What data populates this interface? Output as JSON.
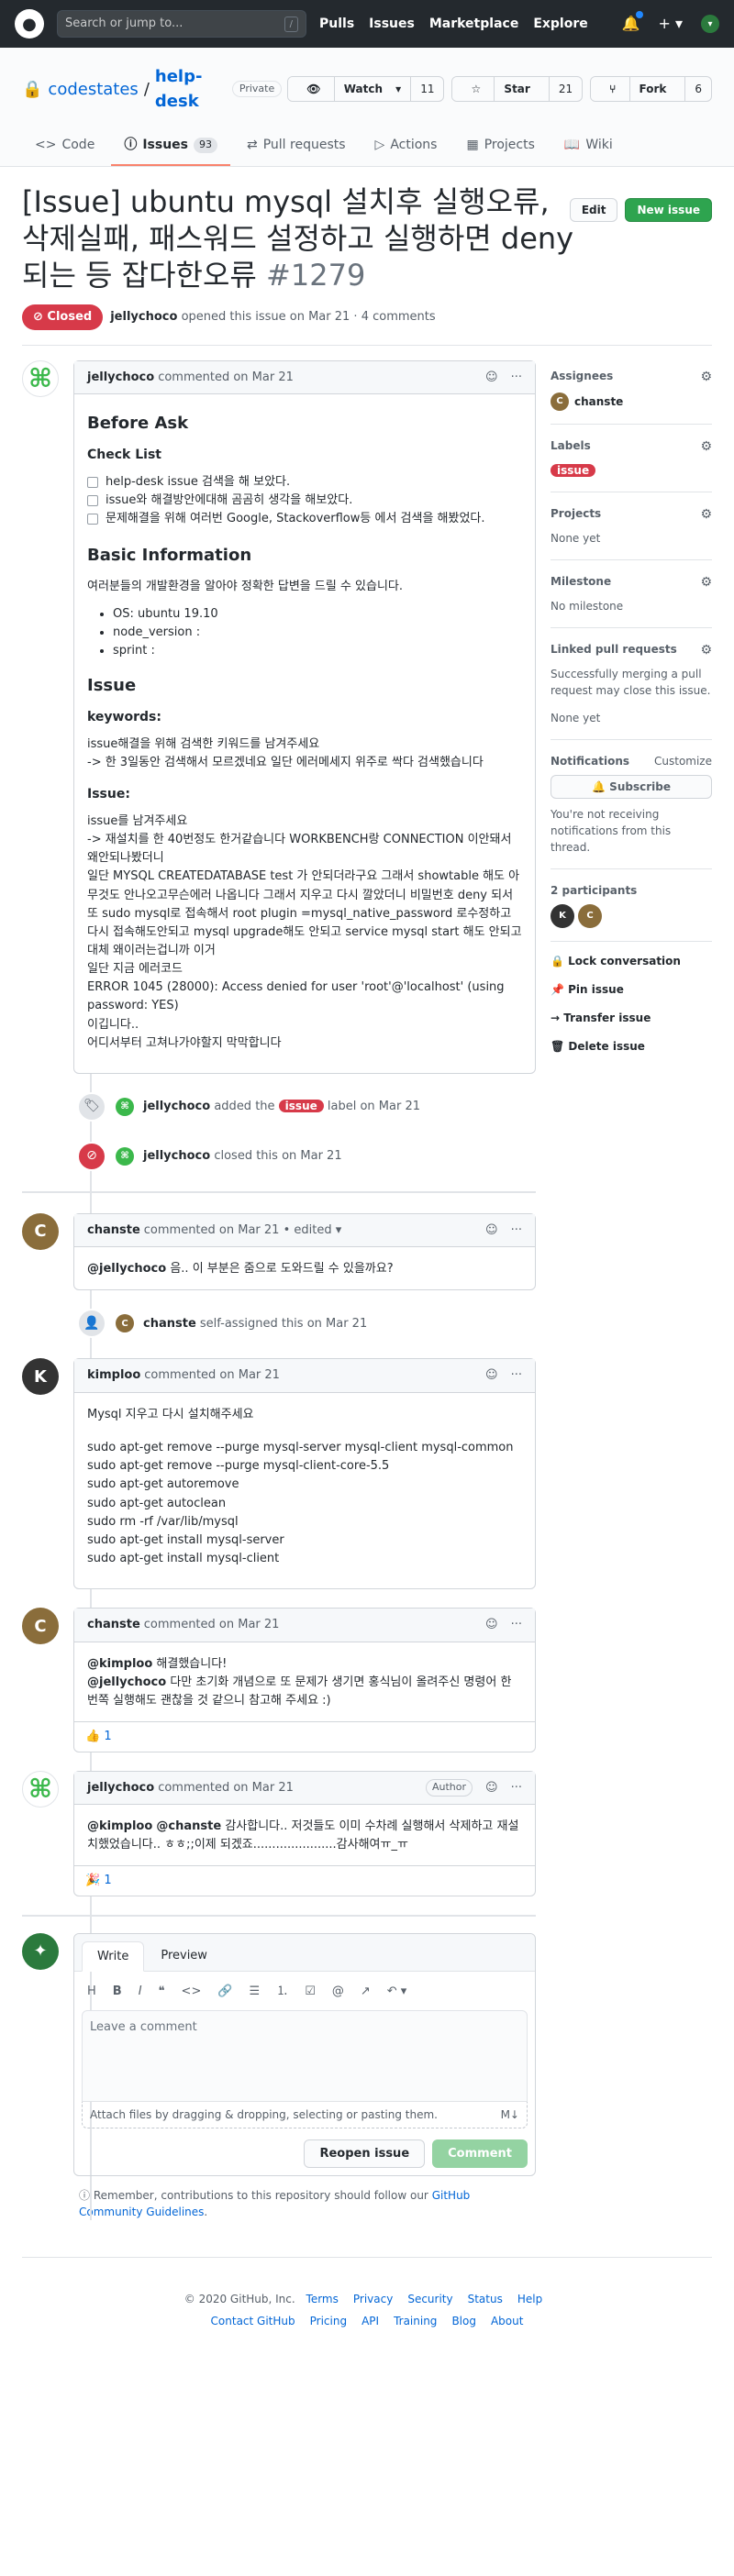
{
  "header": {
    "search_placeholder": "Search or jump to...",
    "search_kbd": "/",
    "nav": [
      "Pulls",
      "Issues",
      "Marketplace",
      "Explore"
    ]
  },
  "repo": {
    "owner": "codestates",
    "name": "help-desk",
    "visibility": "Private",
    "watch_label": "Watch",
    "watch_count": "11",
    "star_label": "Star",
    "star_count": "21",
    "fork_label": "Fork",
    "fork_count": "6",
    "tabs": [
      {
        "label": "Code"
      },
      {
        "label": "Issues",
        "count": "93"
      },
      {
        "label": "Pull requests"
      },
      {
        "label": "Actions"
      },
      {
        "label": "Projects"
      },
      {
        "label": "Wiki"
      }
    ]
  },
  "issue": {
    "title": "[Issue] ubuntu mysql 설치후 실행오류, 삭제실패, 패스워드 설정하고 실행하면 deny되는 등 잡다한오류",
    "number": "#1279",
    "edit_label": "Edit",
    "new_label": "New issue",
    "state": "Closed",
    "author": "jellychoco",
    "meta": "opened this issue on Mar 21 · 4 comments"
  },
  "first_comment": {
    "author": "jellychoco",
    "meta": "commented on Mar 21",
    "h_before": "Before Ask",
    "h_checklist": "Check List",
    "checklist": [
      "help-desk issue 검색을 해 보았다.",
      "issue와 해결방안에대해 곰곰히 생각을 해보았다.",
      "문제해결을 위해 여러번 Google, Stackoverflow등 에서 검색을 해봤었다."
    ],
    "h_basic": "Basic Information",
    "basic_intro": "여러분들의 개발환경을 알아야 정확한 답변을 드릴 수 있습니다.",
    "basic_list": [
      "OS: ubuntu 19.10",
      "node_version :",
      "sprint :"
    ],
    "h_issue": "Issue",
    "h_keywords": "keywords:",
    "keywords_text": "issue해결을 위해 검색한 키워드를 남겨주세요\n-> 한 3일동안 검색해서 모르겠네요 일단 에러메세지 위주로 싹다 검색했습니다",
    "h_issue2": "Issue:",
    "issue_text": "issue를 남겨주세요\n-> 재설치를 한 40번정도 한거같습니다 WORKBENCH랑 CONNECTION 이안돼서 왜안되나봤더니\n일단 MYSQL CREATEDATABASE test 가 안되더라구요 그래서 showtable 해도 아무것도 안나오고무슨에러 나옵니다 그래서 지우고 다시 깔았더니 비밀번호 deny 되서 또 sudo mysql로 접속해서 root plugin =mysql_native_password 로수정하고 다시 접속해도안되고 mysql upgrade해도 안되고 service mysql start 해도 안되고 대체 왜이러는겁니까 이거\n일단 지금 에러코드\nERROR 1045 (28000): Access denied for user 'root'@'localhost' (using password: YES)\n이깁니다..\n어디서부터 고쳐나가야할지 막막합니다"
  },
  "events": {
    "label_actor": "jellychoco",
    "label_pre": "added the",
    "label_name": "issue",
    "label_post": "label on Mar 21",
    "closed_actor": "jellychoco",
    "closed_text": "closed this on Mar 21",
    "assign_actor": "chanste",
    "assign_text": "self-assigned this on Mar 21"
  },
  "comments": [
    {
      "author": "chanste",
      "meta": "commented on Mar 21 • edited ▾",
      "mention": "@jellychoco",
      "text": " 음.. 이 부분은 줌으로 도와드릴 수 있을까요?"
    },
    {
      "author": "kimploo",
      "meta": "commented on Mar 21",
      "text": "Mysql 지우고 다시 설치해주세요",
      "code": "sudo apt-get remove --purge mysql-server mysql-client mysql-common\nsudo apt-get remove --purge mysql-client-core-5.5\nsudo apt-get autoremove\nsudo apt-get autoclean\nsudo rm -rf /var/lib/mysql\nsudo apt-get install mysql-server\nsudo apt-get install mysql-client"
    },
    {
      "author": "chanste",
      "meta": "commented on Mar 21",
      "mention1": "@kimploo",
      "text1": " 해결했습니다!",
      "mention2": "@jellychoco",
      "text2": " 다만 초기화 개념으로 또 문제가 생기면 홍식님이 올려주신 명령어 한번쪽 실행해도 괜찮을 것 같으니 참고해 주세요 :)",
      "reaction": "👍 1"
    },
    {
      "author": "jellychoco",
      "meta": "commented on Mar 21",
      "badge": "Author",
      "mention1": "@kimploo",
      "mention2": "@chanste",
      "text": " 감사합니다.. 저것들도 이미 수차례 실행해서 삭제하고 재설치했었습니다.. ㅎㅎ;;이제 되겠죠......................감사해여ㅠ_ㅠ",
      "reaction": "🎉 1"
    }
  ],
  "form": {
    "tab_write": "Write",
    "tab_preview": "Preview",
    "placeholder": "Leave a comment",
    "attach": "Attach files by dragging & dropping, selecting or pasting them.",
    "reopen": "Reopen issue",
    "comment": "Comment",
    "tip_pre": "Remember, contributions to this repository should follow our",
    "tip_link": "GitHub Community Guidelines",
    "tip_post": "."
  },
  "sidebar": {
    "assignees_h": "Assignees",
    "assignee": "chanste",
    "labels_h": "Labels",
    "label": "issue",
    "projects_h": "Projects",
    "projects_val": "None yet",
    "milestone_h": "Milestone",
    "milestone_val": "No milestone",
    "linked_h": "Linked pull requests",
    "linked_desc": "Successfully merging a pull request may close this issue.",
    "linked_val": "None yet",
    "notif_h": "Notifications",
    "notif_customize": "Customize",
    "subscribe": "Subscribe",
    "notif_desc": "You're not receiving notifications from this thread.",
    "participants_h": "2 participants",
    "lock": "Lock conversation",
    "pin": "Pin issue",
    "transfer": "Transfer issue",
    "delete": "Delete issue"
  },
  "footer": {
    "copyright": "© 2020 GitHub, Inc.",
    "row1": [
      "Terms",
      "Privacy",
      "Security",
      "Status",
      "Help"
    ],
    "row2": [
      "Contact GitHub",
      "Pricing",
      "API",
      "Training",
      "Blog",
      "About"
    ]
  },
  "colors": {
    "closed": "#d73a49",
    "label_issue": "#d73a49",
    "green": "#2ea44f",
    "link": "#0366d6"
  }
}
